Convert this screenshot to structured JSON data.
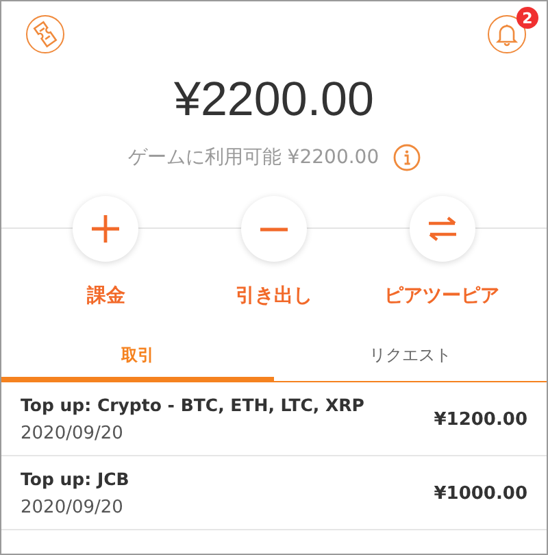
{
  "header": {
    "notification_count": "2"
  },
  "balance": {
    "amount": "¥2200.00",
    "available": "ゲームに利用可能 ¥2200.00"
  },
  "actions": [
    {
      "kind": "add",
      "label": "課金"
    },
    {
      "kind": "withdraw",
      "label": "引き出し"
    },
    {
      "kind": "transfer",
      "label": "ピアツーピア"
    }
  ],
  "tabs": [
    {
      "label": "取引",
      "selected": true
    },
    {
      "label": "リクエスト",
      "selected": false
    }
  ],
  "transactions": [
    {
      "title": "Top up: Crypto - BTC, ETH, LTC, XRP",
      "date": "2020/09/20",
      "amount": "¥1200.00"
    },
    {
      "title": "Top up: JCB",
      "date": "2020/09/20",
      "amount": "¥1000.00"
    }
  ]
}
